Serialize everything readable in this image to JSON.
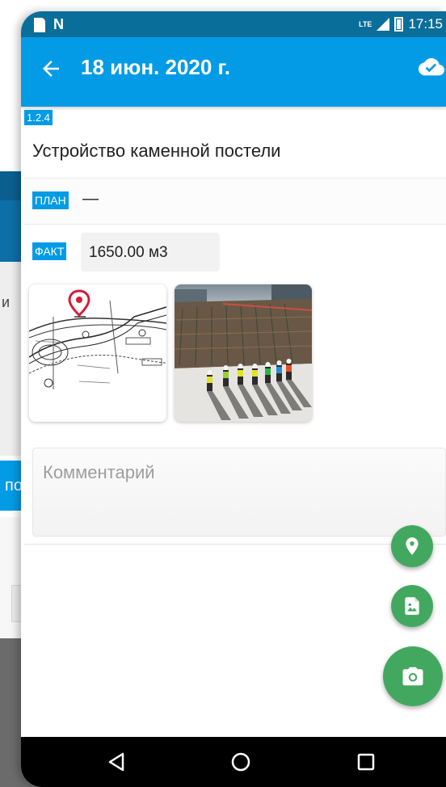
{
  "background": {
    "partial_text": "и",
    "partial_button": "по"
  },
  "statusbar": {
    "network": "LTE",
    "time": "17:15"
  },
  "appbar": {
    "title": "18 июн. 2020 г.",
    "back_icon": "arrow-back-icon",
    "sync_icon": "cloud-done-icon"
  },
  "work": {
    "code": "1.2.4",
    "title": "Устройство каменной постели"
  },
  "plan": {
    "label": "ПЛАН",
    "value": "—"
  },
  "fact": {
    "label": "ФАКТ",
    "value": "1650.00 м3"
  },
  "photos": [
    {
      "kind": "drawing-with-location-pin"
    },
    {
      "kind": "construction-site-photo"
    }
  ],
  "comment": {
    "placeholder": "Комментарий",
    "value": ""
  },
  "fabs": {
    "location_icon": "map-marker-icon",
    "image_icon": "image-file-icon",
    "camera_icon": "camera-icon",
    "color": "#43a85f"
  },
  "colors": {
    "primary": "#039be5",
    "status_bar": "#0a6e9a",
    "accent_green": "#43a85f"
  }
}
